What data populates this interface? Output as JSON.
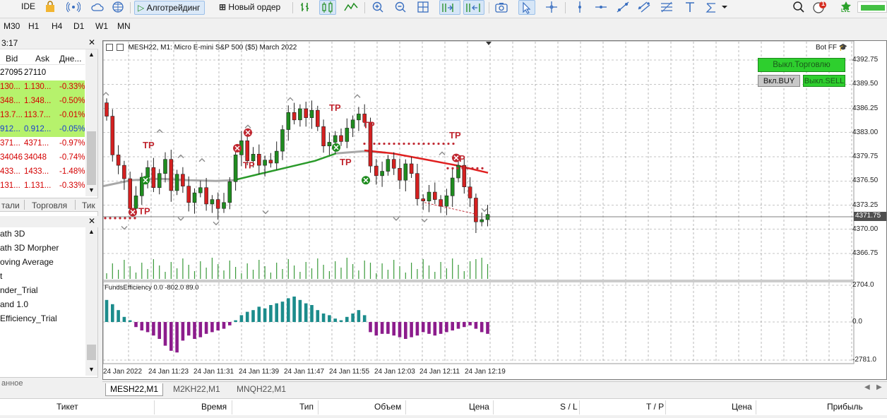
{
  "toolbar": {
    "ide_label": "IDE",
    "algo_label": "Алготрейдинг",
    "neworder_label": "Новый ордер",
    "notification_count": "1",
    "lvl_label": "LVL"
  },
  "timeframes": [
    "M30",
    "H1",
    "H4",
    "D1",
    "W1",
    "MN"
  ],
  "market_watch": {
    "time": "3:17",
    "headers": [
      "Bid",
      "Ask",
      "Дне..."
    ],
    "rows": [
      {
        "bid": "27095",
        "ask": "27110",
        "change": "",
        "bg": "#ffffff",
        "color": "#000000"
      },
      {
        "bid": "130...",
        "ask": "1.130...",
        "change": "-0.33%",
        "bg": "#b6f26c",
        "color": "#d40000"
      },
      {
        "bid": "348...",
        "ask": "1.348...",
        "change": "-0.50%",
        "bg": "#b6f26c",
        "color": "#d40000"
      },
      {
        "bid": "13.7...",
        "ask": "113.7...",
        "change": "-0.01%",
        "bg": "#b6f26c",
        "color": "#d40000"
      },
      {
        "bid": "912...",
        "ask": "0.912...",
        "change": "-0.05%",
        "bg": "#b6f26c",
        "color": "#1a3fd0"
      },
      {
        "bid": "371...",
        "ask": "4371...",
        "change": "-0.97%",
        "bg": "#ffffff",
        "color": "#d40000"
      },
      {
        "bid": "34046",
        "ask": "34048",
        "change": "-0.74%",
        "bg": "#ffffff",
        "color": "#d40000"
      },
      {
        "bid": "433...",
        "ask": "1433...",
        "change": "-1.48%",
        "bg": "#ffffff",
        "color": "#d40000"
      },
      {
        "bid": "131...",
        "ask": "1.131...",
        "change": "-0.33%",
        "bg": "#ffffff",
        "color": "#d40000"
      }
    ],
    "tabs": [
      "тали",
      "Торговля",
      "Тик"
    ]
  },
  "navigator": {
    "items": [
      "ath 3D",
      "ath 3D Morpher",
      "oving Average",
      "t",
      "nder_Trial",
      "and 1.0",
      "Efficiency_Trial"
    ],
    "footer": "анное"
  },
  "chart": {
    "symbol_title": "MESH22, M1:  Micro E-mini S&P 500 ($5) March 2022",
    "ea_name": "Bot FF",
    "btn_disable_trade": "Выкл.Торговлю",
    "btn_buy": "Вкл.BUY",
    "btn_sell": "Выкл.SELL",
    "indicator_title": "FundsEfficiency 0.0 -802.0 89.0",
    "current_price": "4371.75",
    "price_labels": [
      "4392.75",
      "4389.50",
      "4386.25",
      "4383.00",
      "4379.75",
      "4376.50",
      "4373.25",
      "4370.00",
      "4366.75"
    ],
    "indicator_labels": [
      "2704.0",
      "0.0",
      "-2781.0"
    ],
    "time_labels": [
      "24 Jan 2022",
      "24 Jan 11:23",
      "24 Jan 11:31",
      "24 Jan 11:39",
      "24 Jan 11:47",
      "24 Jan 11:55",
      "24 Jan 12:03",
      "24 Jan 12:11",
      "24 Jan 12:19"
    ],
    "tp_label": "TP",
    "colors": {
      "bull": "#1f8c1f",
      "bear": "#d42020",
      "ma_gray": "#a8a8a8",
      "ma_green": "#2a9a2a",
      "ma_red": "#e02020",
      "hist_pos": "#1c8c8c",
      "hist_neg": "#8c1c8c",
      "volume": "#3a9a3a"
    }
  },
  "chart_tabs": [
    "MESH22,M1",
    "M2KH22,M1",
    "MNQH22,M1"
  ],
  "trade_headers": [
    "Тикет",
    "Время",
    "Тип",
    "Объем",
    "Цена",
    "S / L",
    "T / P",
    "Цена",
    "Прибыль"
  ]
}
